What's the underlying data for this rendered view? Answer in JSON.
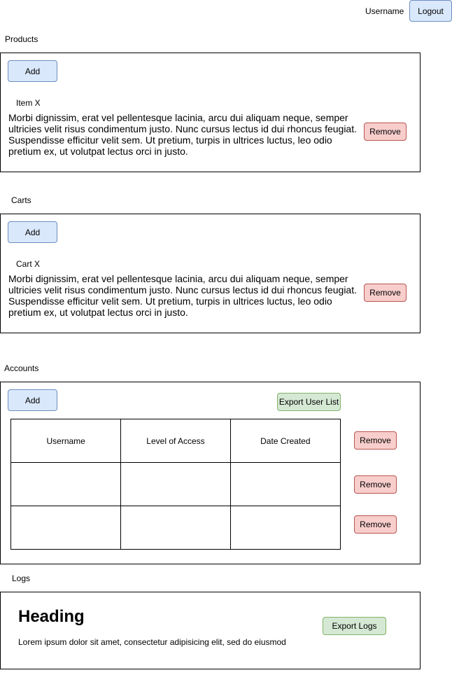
{
  "header": {
    "username_label": "Username",
    "logout_label": "Logout"
  },
  "products": {
    "section_title": "Products",
    "add_label": "Add",
    "item_title": "Item X",
    "item_text": "Morbi dignissim, erat vel pellentesque lacinia, arcu dui aliquam neque, semper ultricies velit risus condimentum justo. Nunc cursus lectus id dui rhoncus feugiat. Suspendisse efficitur velit sem. Ut pretium, turpis in ultrices luctus, leo odio pretium ex, ut volutpat lectus orci in justo.",
    "remove_label": "Remove"
  },
  "carts": {
    "section_title": "Carts",
    "add_label": "Add",
    "item_title": "Cart X",
    "item_text": "Morbi dignissim, erat vel pellentesque lacinia, arcu dui aliquam neque, semper ultricies velit risus condimentum justo. Nunc cursus lectus id dui rhoncus feugiat. Suspendisse efficitur velit sem. Ut pretium, turpis in ultrices luctus, leo odio pretium ex, ut volutpat lectus orci in justo.",
    "remove_label": "Remove"
  },
  "accounts": {
    "section_title": "Accounts",
    "add_label": "Add",
    "export_label": "Export User List",
    "columns": [
      "Username",
      "Level of Access",
      "Date Created"
    ],
    "rows": [
      [
        "",
        "",
        ""
      ],
      [
        "",
        "",
        ""
      ]
    ],
    "remove_labels": [
      "Remove",
      "Remove",
      "Remove"
    ]
  },
  "logs": {
    "section_title": "Logs",
    "heading": "Heading",
    "text": "Lorem ipsum dolor sit amet, consectetur adipisicing elit, sed do eiusmod",
    "export_label": "Export Logs"
  }
}
